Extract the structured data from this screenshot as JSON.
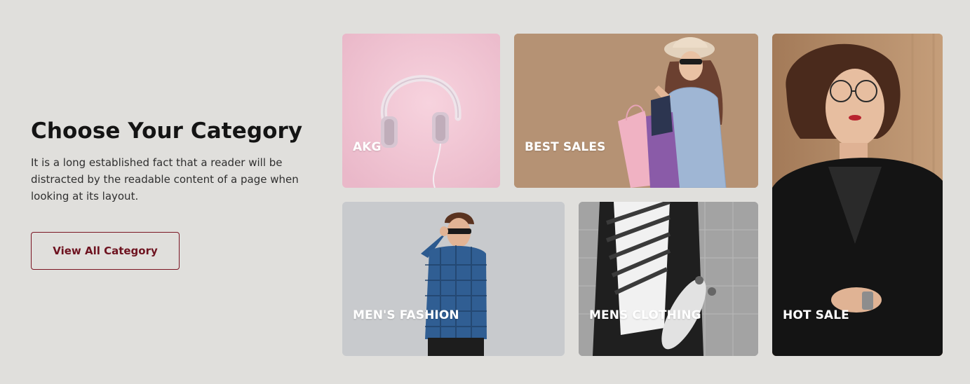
{
  "section": {
    "title": "Choose Your Category",
    "description": "It is a long established fact that a reader will be distracted by the readable content of a page when looking at its layout.",
    "button_label": "View All Category"
  },
  "categories": [
    {
      "label": "AKG"
    },
    {
      "label": "BEST SALES"
    },
    {
      "label": "MEN'S FASHION"
    },
    {
      "label": "MENS CLOTHING"
    },
    {
      "label": "HOT SALE"
    }
  ],
  "colors": {
    "background": "#e0dfdc",
    "accent": "#7a1523",
    "heading": "#141414"
  }
}
